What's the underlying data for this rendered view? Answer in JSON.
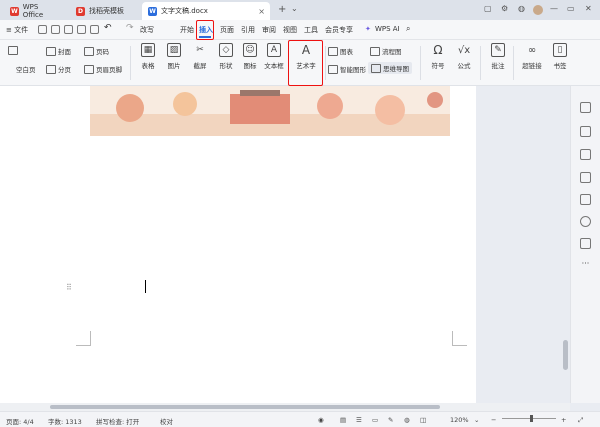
{
  "titlebar": {
    "tabs": [
      {
        "label": "WPS Office",
        "icon": "wps-logo-icon",
        "color": "#e03a2f"
      },
      {
        "label": "找稻壳模板",
        "icon": "docer-icon",
        "color": "#e03a2f"
      },
      {
        "label": "文字文稿.docx",
        "icon": "word-doc-icon",
        "color": "#2b6ddc"
      }
    ],
    "new_tab": "+",
    "tab_close": "×"
  },
  "menubar": {
    "file": "≡ 文件",
    "undo_label": "改写",
    "tabs": [
      "开始",
      "插入",
      "页面",
      "引用",
      "审阅",
      "视图",
      "工具",
      "会员专享"
    ],
    "wps_ai": "WPS AI"
  },
  "ribbon": {
    "blank_page": "空白页",
    "cover": "封面",
    "section": "分页",
    "page_number": "页码",
    "header_footer": "页眉页脚",
    "table": "表格",
    "picture": "图片",
    "screenshot": "截屏",
    "shape": "形状",
    "icon": "图标",
    "textbox": "文本框",
    "wordart": "艺术字",
    "chart": "图表",
    "smart_graphic": "智能图形",
    "flowchart": "流程图",
    "mindmap": "思维导图",
    "symbol": "符号",
    "formula": "公式",
    "comment": "批注",
    "hyperlink": "超链接",
    "bookmark": "书签"
  },
  "statusbar": {
    "page": "页面: 4/4",
    "words": "字数: 1313",
    "spellcheck": "拼写检查: 打开",
    "proofread": "校对",
    "zoom": "120%"
  },
  "colors": {
    "accent": "#2b6ddc",
    "highlight": "#e11111"
  }
}
